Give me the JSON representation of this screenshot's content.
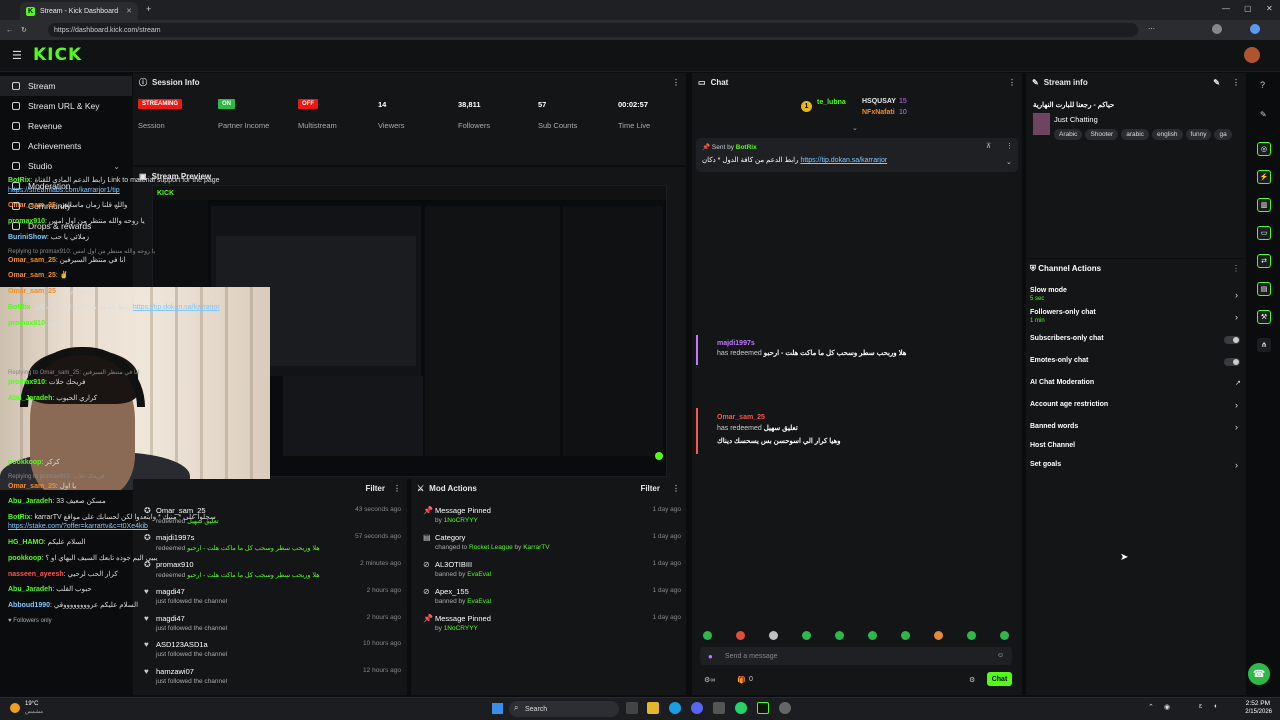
{
  "browser": {
    "tab_title": "Stream - Kick Dashboard",
    "url": "https://dashboard.kick.com/stream"
  },
  "logo": "KICK",
  "sidebar": {
    "items": [
      {
        "label": "Stream",
        "active": true
      },
      {
        "label": "Stream URL & Key"
      },
      {
        "label": "Revenue"
      },
      {
        "label": "Achievements"
      },
      {
        "label": "Studio",
        "expand": true
      },
      {
        "label": "Moderation"
      },
      {
        "label": "Community",
        "expand": true
      },
      {
        "label": "Drops & rewards"
      }
    ]
  },
  "session": {
    "title": "Session Info",
    "stats": [
      {
        "badge": "STREAMING",
        "badge_color": "#e91916",
        "label": "Session"
      },
      {
        "badge": "ON",
        "badge_color": "#2fb84a",
        "label": "Partner Income"
      },
      {
        "badge": "OFF",
        "badge_color": "#e91916",
        "label": "Multistream"
      },
      {
        "value": "14",
        "label": "Viewers"
      },
      {
        "value": "38,811",
        "label": "Followers"
      },
      {
        "value": "57",
        "label": "Sub Counts"
      },
      {
        "value": "00:02:57",
        "label": "Time Live"
      }
    ]
  },
  "preview": {
    "title": "Stream Preview"
  },
  "activity": {
    "filter": "Filter",
    "items": [
      {
        "name": "Omar_sam_25",
        "action": "redeemed",
        "detail": "تعليق سهيل",
        "time": "43 seconds ago"
      },
      {
        "name": "majdi1997s",
        "action": "redeemed",
        "detail": "هلا وربحب سطر وسحب كل ما ماكت هلت - ارحبو",
        "time": "57 seconds ago"
      },
      {
        "name": "promax910",
        "action": "redeemed",
        "detail": "هلا وربحب سطر وسحب كل ما ماكت هلت - ارحبو",
        "time": "2 minutes ago"
      },
      {
        "name": "magdi47",
        "action": "just followed the channel",
        "detail": "",
        "time": "2 hours ago"
      },
      {
        "name": "magdi47",
        "action": "just followed the channel",
        "detail": "",
        "time": "2 hours ago"
      },
      {
        "name": "ASD123ASD1a",
        "action": "just followed the channel",
        "detail": "",
        "time": "10 hours ago"
      },
      {
        "name": "hamzawi07",
        "action": "just followed the channel",
        "detail": "",
        "time": "12 hours ago"
      }
    ]
  },
  "mod": {
    "title": "Mod Actions",
    "filter": "Filter",
    "items": [
      {
        "title": "Message Pinned",
        "prefix": "by",
        "who": "1NoCRYYY",
        "time": "1 day ago"
      },
      {
        "title": "Category",
        "prefix": "changed to",
        "who": "Rocket League",
        "suffix": "by",
        "who2": "KarrarTV",
        "time": "1 day ago"
      },
      {
        "title": "AL3OTIBIII",
        "prefix": "banned by",
        "who": "EvaEval",
        "time": "1 day ago"
      },
      {
        "title": "Apex_155",
        "prefix": "banned by",
        "who": "EvaEval",
        "time": "1 day ago"
      },
      {
        "title": "Message Pinned",
        "prefix": "by",
        "who": "1NoCRYYY",
        "time": "1 day ago"
      }
    ]
  },
  "chat": {
    "title": "Chat",
    "top_gifters": [
      {
        "name": "te_lubna",
        "count": "1"
      },
      {
        "name": "HSQUSAY",
        "count": "15"
      },
      {
        "name": "NFxNafati",
        "count": "10"
      }
    ],
    "pinned": {
      "sent_by": "Sent by",
      "who": "BotRix",
      "text": "رابط الدعم من كافة الدول * دكان",
      "link": "https://tip.dokan.sa/karrarjor"
    },
    "messages": [
      {
        "user": "BotRix",
        "color": "cg",
        "text": "رابط الدعم المادي للقناة Link to material support for the page"
      },
      {
        "user": "",
        "color": "",
        "text": "",
        "link": "https://streamlabs.com/karrarjor1/tip"
      },
      {
        "user": "Omar_sam_25",
        "color": "ca",
        "text": "والله قلنا زمان ماسالني"
      },
      {
        "user": "promax910",
        "color": "cg",
        "text": "يا روحه والله منتظر من اول امس"
      },
      {
        "user": "BuriniShow",
        "color": "cb",
        "text": "زملائي يا حب"
      },
      {
        "user": "",
        "color": "",
        "text": "Replying to promax910: يا روحه والله منتظر من اول امس",
        "reply": true
      },
      {
        "user": "Omar_sam_25",
        "color": "ca",
        "text": "انا في منتظر السيرفين"
      },
      {
        "user": "Omar_sam_25",
        "color": "ca",
        "text": "✌"
      },
      {
        "user": "Omar_sam_25",
        "color": "ca",
        "text": "حياك يرجل"
      },
      {
        "user": "BotRix",
        "color": "cg",
        "text": "رابط الدعم من كافة الدول * دكان",
        "link": "https://tip.dokan.sa/karrarjor"
      },
      {
        "user": "promax910",
        "color": "cg",
        "text": "كفوو"
      }
    ],
    "redeem1": {
      "user": "majdi1997s",
      "action": "has redeemed",
      "detail": "هلا وربحب سطر وسحب كل ما ماكت هلت - ارحبو"
    },
    "messages2": [
      {
        "user": "",
        "text": "Replying to Omar_sam_25: انا في منتظر السيرفين",
        "reply": true
      },
      {
        "user": "promax910",
        "color": "cg",
        "text": "فريحك حلات"
      },
      {
        "user": "Abu_Jaradeh",
        "color": "cg",
        "text": "كراري الحبوب"
      }
    ],
    "redeem2": {
      "user": "Omar_sam_25",
      "action": "has redeemed",
      "detail": "تعليق سهيل",
      "sub": "وهيا كرار الي اسوحسن بس يسحسك ديناك"
    },
    "messages3": [
      {
        "user": "pookkoop",
        "color": "cg",
        "text": "كركر"
      },
      {
        "user": "",
        "text": "Replying to promax910: فريحك حلات",
        "reply": true
      },
      {
        "user": "Omar_sam_25",
        "color": "ca",
        "text": "يا اول"
      },
      {
        "user": "Abu_Jaradeh",
        "color": "cg",
        "text": "33 مسكن صعيف"
      },
      {
        "user": "BotRix",
        "color": "cg",
        "text": "karrarTV سجلوا على * منيك * وابتعدوا لكن لحسابك على مواقع",
        "link": "https://stake.com/?offer=karrartv&c=t0Xe4kib"
      },
      {
        "user": "HG_HAMO",
        "color": "cg",
        "text": "السلام عليكم"
      },
      {
        "user": "pookkoop",
        "color": "cg",
        "text": "يبيي اليم جوده تابعك السيف البهاي او ؟"
      },
      {
        "user": "nasseen_ayeesh",
        "color": "cr",
        "text": "كرار الحب لرحيي"
      },
      {
        "user": "Abu_Jaradeh",
        "color": "cg",
        "text": "حبوب القلب"
      },
      {
        "user": "Abboud1990",
        "color": "cb",
        "text": "السلام عليكم عرووووووووقي"
      }
    ],
    "mode": "Followers only",
    "input_placeholder": "Send a message",
    "viewer_count": "0",
    "send_label": "Chat"
  },
  "stream_info": {
    "title": "Stream info",
    "stream_title": "حياكم - رجعنا للبارت النهارية",
    "category": "Just Chatting",
    "tags": [
      "Arabic",
      "Shooter",
      "arabic",
      "english",
      "funny",
      "ga"
    ]
  },
  "channel_actions": {
    "title": "Channel Actions",
    "items": [
      {
        "label": "Slow mode",
        "sub": "5 sec",
        "control": "chevron"
      },
      {
        "label": "Followers-only chat",
        "sub": "1 min",
        "control": "chevron"
      },
      {
        "label": "Subscribers-only chat",
        "sub": "",
        "control": "toggle"
      },
      {
        "label": "Emotes-only chat",
        "sub": "",
        "control": "toggle"
      },
      {
        "label": "AI Chat Moderation",
        "sub": "",
        "control": "external"
      },
      {
        "label": "Account age restriction",
        "sub": "",
        "control": "chevron"
      },
      {
        "label": "Banned words",
        "sub": "",
        "control": "chevron"
      },
      {
        "label": "Host Channel",
        "sub": "",
        "control": "none"
      },
      {
        "label": "Set goals",
        "sub": "",
        "control": "chevron"
      }
    ]
  },
  "taskbar": {
    "weather": "19°C",
    "weather_sub": "مشمس",
    "search": "Search",
    "time": "2:52 PM",
    "date": "2/15/2026"
  },
  "colors": {
    "brand": "#53fc18",
    "live": "#e91916",
    "on": "#2fb84a",
    "panel": "#141517"
  }
}
